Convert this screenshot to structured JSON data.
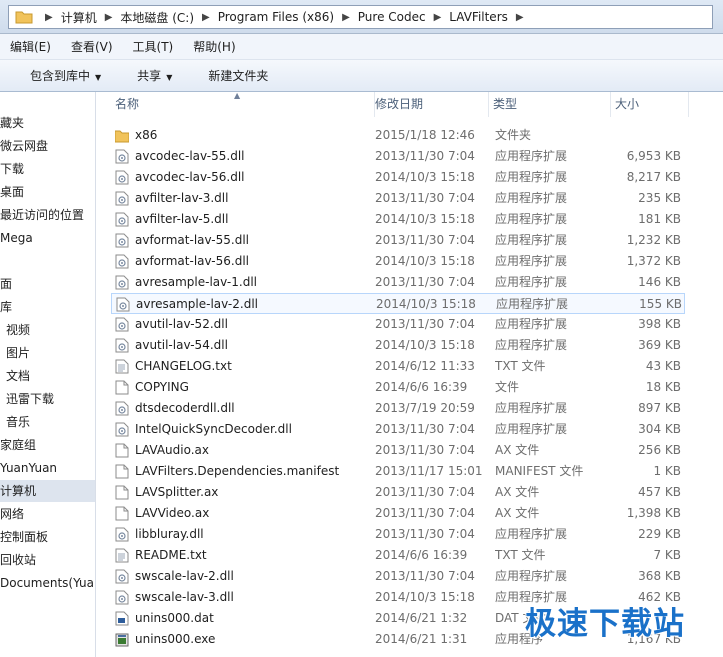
{
  "address": {
    "crumbs": [
      "计算机",
      "本地磁盘 (C:)",
      "Program Files (x86)",
      "Pure Codec",
      "LAVFilters"
    ]
  },
  "menu": [
    "编辑(E)",
    "查看(V)",
    "工具(T)",
    "帮助(H)"
  ],
  "toolbar": {
    "include_library": "包含到库中",
    "share": "共享",
    "new_folder": "新建文件夹"
  },
  "nav": [
    {
      "label": "藏夹",
      "icon": "none"
    },
    {
      "label": "微云网盘",
      "icon": "none"
    },
    {
      "label": "下载",
      "icon": "none"
    },
    {
      "label": "桌面",
      "icon": "none"
    },
    {
      "label": "最近访问的位置",
      "icon": "none"
    },
    {
      "label": "Mega",
      "icon": "none"
    },
    {
      "label": "面",
      "icon": "none"
    },
    {
      "label": "库",
      "icon": "none"
    },
    {
      "label": "视频",
      "icon": "none"
    },
    {
      "label": "图片",
      "icon": "none"
    },
    {
      "label": "文档",
      "icon": "none"
    },
    {
      "label": "迅雷下载",
      "icon": "none"
    },
    {
      "label": "音乐",
      "icon": "none"
    },
    {
      "label": "家庭组",
      "icon": "none"
    },
    {
      "label": "YuanYuan",
      "icon": "none"
    },
    {
      "label": "计算机",
      "icon": "none"
    },
    {
      "label": "网络",
      "icon": "none"
    },
    {
      "label": "控制面板",
      "icon": "none"
    },
    {
      "label": "回收站",
      "icon": "none"
    },
    {
      "label": "Documents(Yuan",
      "icon": "none"
    }
  ],
  "columns": {
    "name": "名称",
    "date": "修改日期",
    "type": "类型",
    "size": "大小"
  },
  "files": [
    {
      "name": "x86",
      "date": "2015/1/18 12:46",
      "type": "文件夹",
      "size": "",
      "icon": "folder-icon"
    },
    {
      "name": "avcodec-lav-55.dll",
      "date": "2013/11/30 7:04",
      "type": "应用程序扩展",
      "size": "6,953 KB",
      "icon": "dll-file-icon"
    },
    {
      "name": "avcodec-lav-56.dll",
      "date": "2014/10/3 15:18",
      "type": "应用程序扩展",
      "size": "8,217 KB",
      "icon": "dll-file-icon"
    },
    {
      "name": "avfilter-lav-3.dll",
      "date": "2013/11/30 7:04",
      "type": "应用程序扩展",
      "size": "235 KB",
      "icon": "dll-file-icon"
    },
    {
      "name": "avfilter-lav-5.dll",
      "date": "2014/10/3 15:18",
      "type": "应用程序扩展",
      "size": "181 KB",
      "icon": "dll-file-icon"
    },
    {
      "name": "avformat-lav-55.dll",
      "date": "2013/11/30 7:04",
      "type": "应用程序扩展",
      "size": "1,232 KB",
      "icon": "dll-file-icon"
    },
    {
      "name": "avformat-lav-56.dll",
      "date": "2014/10/3 15:18",
      "type": "应用程序扩展",
      "size": "1,372 KB",
      "icon": "dll-file-icon"
    },
    {
      "name": "avresample-lav-1.dll",
      "date": "2013/11/30 7:04",
      "type": "应用程序扩展",
      "size": "146 KB",
      "icon": "dll-file-icon"
    },
    {
      "name": "avresample-lav-2.dll",
      "date": "2014/10/3 15:18",
      "type": "应用程序扩展",
      "size": "155 KB",
      "icon": "dll-file-icon"
    },
    {
      "name": "avutil-lav-52.dll",
      "date": "2013/11/30 7:04",
      "type": "应用程序扩展",
      "size": "398 KB",
      "icon": "dll-file-icon"
    },
    {
      "name": "avutil-lav-54.dll",
      "date": "2014/10/3 15:18",
      "type": "应用程序扩展",
      "size": "369 KB",
      "icon": "dll-file-icon"
    },
    {
      "name": "CHANGELOG.txt",
      "date": "2014/6/12 11:33",
      "type": "TXT 文件",
      "size": "43 KB",
      "icon": "text-file-icon"
    },
    {
      "name": "COPYING",
      "date": "2014/6/6 16:39",
      "type": "文件",
      "size": "18 KB",
      "icon": "blank-file-icon"
    },
    {
      "name": "dtsdecoderdll.dll",
      "date": "2013/7/19 20:59",
      "type": "应用程序扩展",
      "size": "897 KB",
      "icon": "dll-file-icon"
    },
    {
      "name": "IntelQuickSyncDecoder.dll",
      "date": "2013/11/30 7:04",
      "type": "应用程序扩展",
      "size": "304 KB",
      "icon": "dll-file-icon"
    },
    {
      "name": "LAVAudio.ax",
      "date": "2013/11/30 7:04",
      "type": "AX 文件",
      "size": "256 KB",
      "icon": "blank-file-icon"
    },
    {
      "name": "LAVFilters.Dependencies.manifest",
      "date": "2013/11/17 15:01",
      "type": "MANIFEST 文件",
      "size": "1 KB",
      "icon": "blank-file-icon"
    },
    {
      "name": "LAVSplitter.ax",
      "date": "2013/11/30 7:04",
      "type": "AX 文件",
      "size": "457 KB",
      "icon": "blank-file-icon"
    },
    {
      "name": "LAVVideo.ax",
      "date": "2013/11/30 7:04",
      "type": "AX 文件",
      "size": "1,398 KB",
      "icon": "blank-file-icon"
    },
    {
      "name": "libbluray.dll",
      "date": "2013/11/30 7:04",
      "type": "应用程序扩展",
      "size": "229 KB",
      "icon": "dll-file-icon"
    },
    {
      "name": "README.txt",
      "date": "2014/6/6 16:39",
      "type": "TXT 文件",
      "size": "7 KB",
      "icon": "text-file-icon"
    },
    {
      "name": "swscale-lav-2.dll",
      "date": "2013/11/30 7:04",
      "type": "应用程序扩展",
      "size": "368 KB",
      "icon": "dll-file-icon"
    },
    {
      "name": "swscale-lav-3.dll",
      "date": "2014/10/3 15:18",
      "type": "应用程序扩展",
      "size": "462 KB",
      "icon": "dll-file-icon"
    },
    {
      "name": "unins000.dat",
      "date": "2014/6/21 1:32",
      "type": "DAT 文件",
      "size": "",
      "icon": "dat-file-icon"
    },
    {
      "name": "unins000.exe",
      "date": "2014/6/21 1:31",
      "type": "应用程序",
      "size": "1,167 KB",
      "icon": "exe-file-icon"
    }
  ],
  "hover_row": 8,
  "watermark": "极速下载站"
}
